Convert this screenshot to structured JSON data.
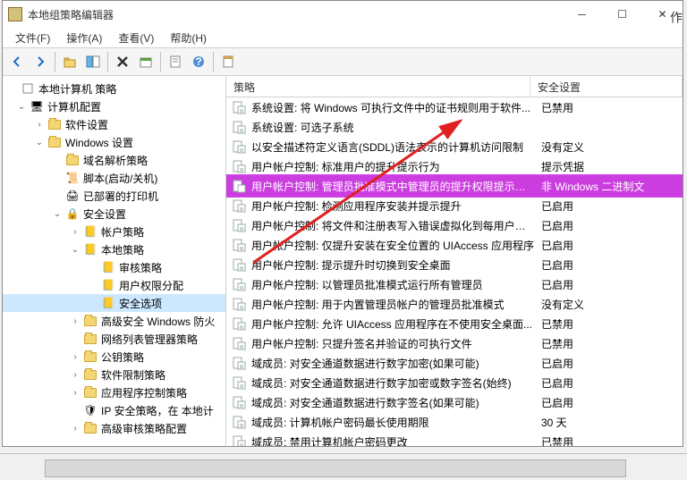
{
  "window": {
    "title": "本地组策略编辑器"
  },
  "menus": {
    "file": "文件(F)",
    "action": "操作(A)",
    "view": "查看(V)",
    "help": "帮助(H)"
  },
  "tree": {
    "root": "本地计算机 策略",
    "computer_config": "计算机配置",
    "software_settings": "软件设置",
    "windows_settings": "Windows 设置",
    "dns_policy": "域名解析策略",
    "scripts": "脚本(启动/关机)",
    "deployed_printers": "已部署的打印机",
    "security_settings": "安全设置",
    "account_policy": "帐户策略",
    "local_policy": "本地策略",
    "audit_policy": "审核策略",
    "user_rights": "用户权限分配",
    "security_options": "安全选项",
    "advanced_firewall": "高级安全 Windows 防火",
    "network_list": "网络列表管理器策略",
    "public_key": "公钥策略",
    "software_restrict": "软件限制策略",
    "app_control": "应用程序控制策略",
    "ip_security": "IP 安全策略，在 本地计",
    "advanced_audit": "高级审核策略配置"
  },
  "columns": {
    "policy": "策略",
    "setting": "安全设置"
  },
  "policies": [
    {
      "name": "系统设置: 将 Windows 可执行文件中的证书规则用于软件...",
      "setting": "已禁用"
    },
    {
      "name": "系统设置: 可选子系统",
      "setting": ""
    },
    {
      "name": "以安全描述符定义语言(SDDL)语法表示的计算机访问限制",
      "setting": "没有定义"
    },
    {
      "name": "用户帐户控制: 标准用户的提升提示行为",
      "setting": "提示凭据"
    },
    {
      "name": "用户帐户控制: 管理员批准模式中管理员的提升权限提示的...",
      "setting": "非 Windows 二进制文",
      "highlighted": true
    },
    {
      "name": "用户帐户控制: 检测应用程序安装并提示提升",
      "setting": "已启用"
    },
    {
      "name": "用户帐户控制: 将文件和注册表写入错误虚拟化到每用户位置",
      "setting": "已启用"
    },
    {
      "name": "用户帐户控制: 仅提升安装在安全位置的 UIAccess 应用程序",
      "setting": "已启用"
    },
    {
      "name": "用户帐户控制: 提示提升时切换到安全桌面",
      "setting": "已启用"
    },
    {
      "name": "用户帐户控制: 以管理员批准模式运行所有管理员",
      "setting": "已启用"
    },
    {
      "name": "用户帐户控制: 用于内置管理员帐户的管理员批准模式",
      "setting": "没有定义"
    },
    {
      "name": "用户帐户控制: 允许 UIAccess 应用程序在不使用安全桌面...",
      "setting": "已禁用"
    },
    {
      "name": "用户帐户控制: 只提升签名并验证的可执行文件",
      "setting": "已禁用"
    },
    {
      "name": "域成员: 对安全通道数据进行数字加密(如果可能)",
      "setting": "已启用"
    },
    {
      "name": "域成员: 对安全通道数据进行数字加密或数字签名(始终)",
      "setting": "已启用"
    },
    {
      "name": "域成员: 对安全通道数据进行数字签名(如果可能)",
      "setting": "已启用"
    },
    {
      "name": "域成员: 计算机帐户密码最长使用期限",
      "setting": "30 天"
    },
    {
      "name": "域成员: 禁用计算机帐户密码更改",
      "setting": "已禁用"
    }
  ],
  "side_label": "作"
}
